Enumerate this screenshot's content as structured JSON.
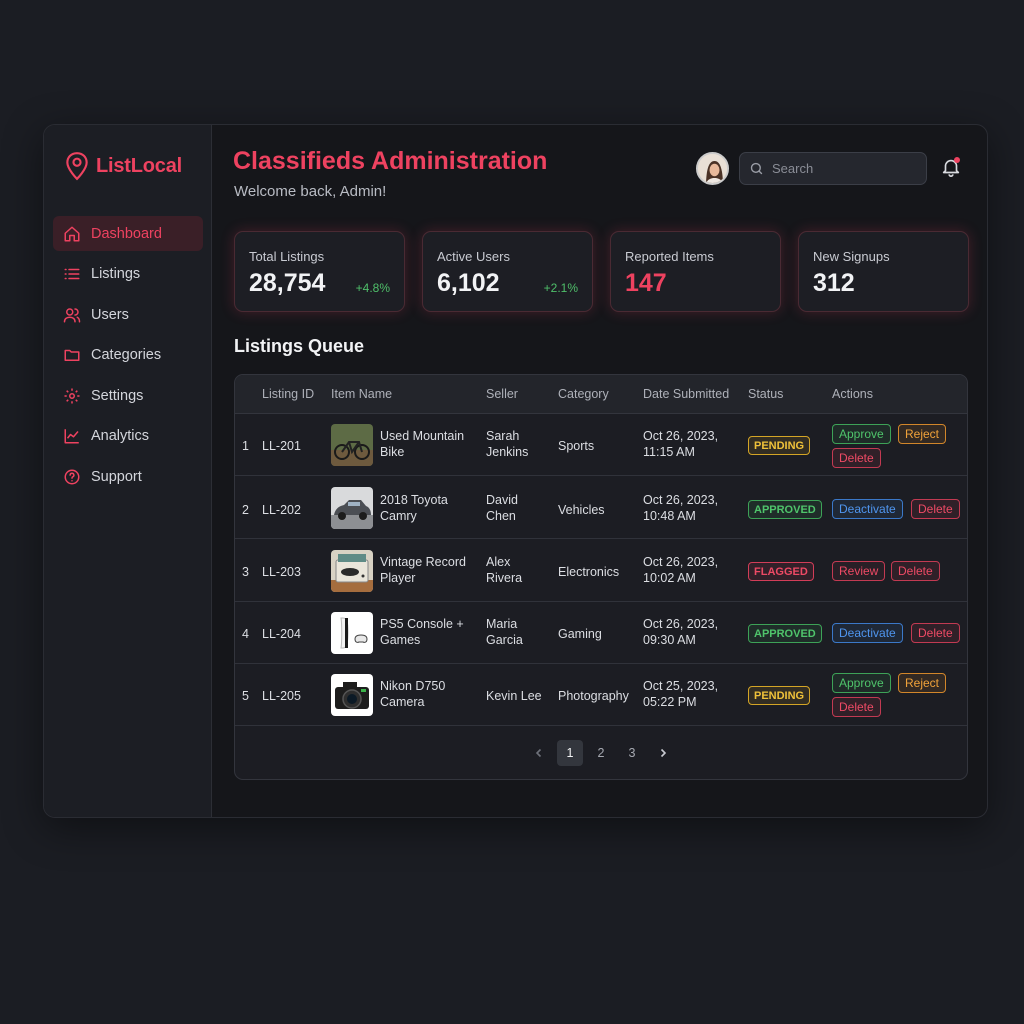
{
  "brand": {
    "name": "ListLocal"
  },
  "nav": [
    {
      "label": "Dashboard",
      "icon": "home-icon",
      "active": true
    },
    {
      "label": "Listings",
      "icon": "list-icon"
    },
    {
      "label": "Users",
      "icon": "users-icon"
    },
    {
      "label": "Categories",
      "icon": "folder-icon"
    },
    {
      "label": "Settings",
      "icon": "gear-icon"
    },
    {
      "label": "Analytics",
      "icon": "chart-line-icon"
    },
    {
      "label": "Support",
      "icon": "help-circle-icon"
    }
  ],
  "header": {
    "title": "Classifieds Administration",
    "welcome": "Welcome back, Admin!",
    "search_placeholder": "Search"
  },
  "stats": [
    {
      "label": "Total Listings",
      "value": "28,754",
      "delta": "+4.8%"
    },
    {
      "label": "Active Users",
      "value": "6,102",
      "delta": "+2.1%"
    },
    {
      "label": "Reported Items",
      "value": "147",
      "delta": ""
    },
    {
      "label": "New Signups",
      "value": "312",
      "delta": ""
    }
  ],
  "queue": {
    "title": "Listings Queue",
    "columns": [
      "Listing ID",
      "Item Name",
      "Seller",
      "Category",
      "Date Submitted",
      "Status",
      "Actions"
    ],
    "rows": [
      {
        "num": "1",
        "id": "LL-201",
        "name1": "Used Mountain",
        "name2": "Bike",
        "seller1": "Sarah",
        "seller2": "Jenkins",
        "category": "Sports",
        "date1": "Oct 26, 2023,",
        "date2": "11:15 AM",
        "status": "PENDING",
        "thumb": "bike-photo"
      },
      {
        "num": "2",
        "id": "LL-202",
        "name1": "2018 Toyota",
        "name2": "Camry",
        "seller1": "David",
        "seller2": "Chen",
        "category": "Vehicles",
        "date1": "Oct 26, 2023,",
        "date2": "10:48 AM",
        "status": "APPROVED",
        "thumb": "car-photo"
      },
      {
        "num": "3",
        "id": "LL-203",
        "name1": "Vintage Record",
        "name2": "Player",
        "seller1": "Alex",
        "seller2": "Rivera",
        "category": "Electronics",
        "date1": "Oct 26, 2023,",
        "date2": "10:02 AM",
        "status": "FLAGGED",
        "thumb": "record-player-photo"
      },
      {
        "num": "4",
        "id": "LL-204",
        "name1": "PS5 Console +",
        "name2": "Games",
        "seller1": "Maria",
        "seller2": "Garcia",
        "category": "Gaming",
        "date1": "Oct 26, 2023,",
        "date2": "09:30 AM",
        "status": "APPROVED",
        "thumb": "console-photo"
      },
      {
        "num": "5",
        "id": "LL-205",
        "name1": "Nikon D750",
        "name2": "Camera",
        "seller1": "Kevin Lee",
        "seller2": "",
        "category": "Photography",
        "date1": "Oct 25, 2023,",
        "date2": "05:22 PM",
        "status": "PENDING",
        "thumb": "camera-photo"
      }
    ],
    "actions": {
      "approve": "Approve",
      "reject": "Reject",
      "delete": "Delete",
      "deactivate": "Deactivate",
      "review": "Review"
    },
    "pages": [
      "1",
      "2",
      "3"
    ],
    "current_page": "1"
  },
  "colors": {
    "accent": "#ee4260",
    "positive": "#4fbf6a",
    "background": "#15161a"
  }
}
